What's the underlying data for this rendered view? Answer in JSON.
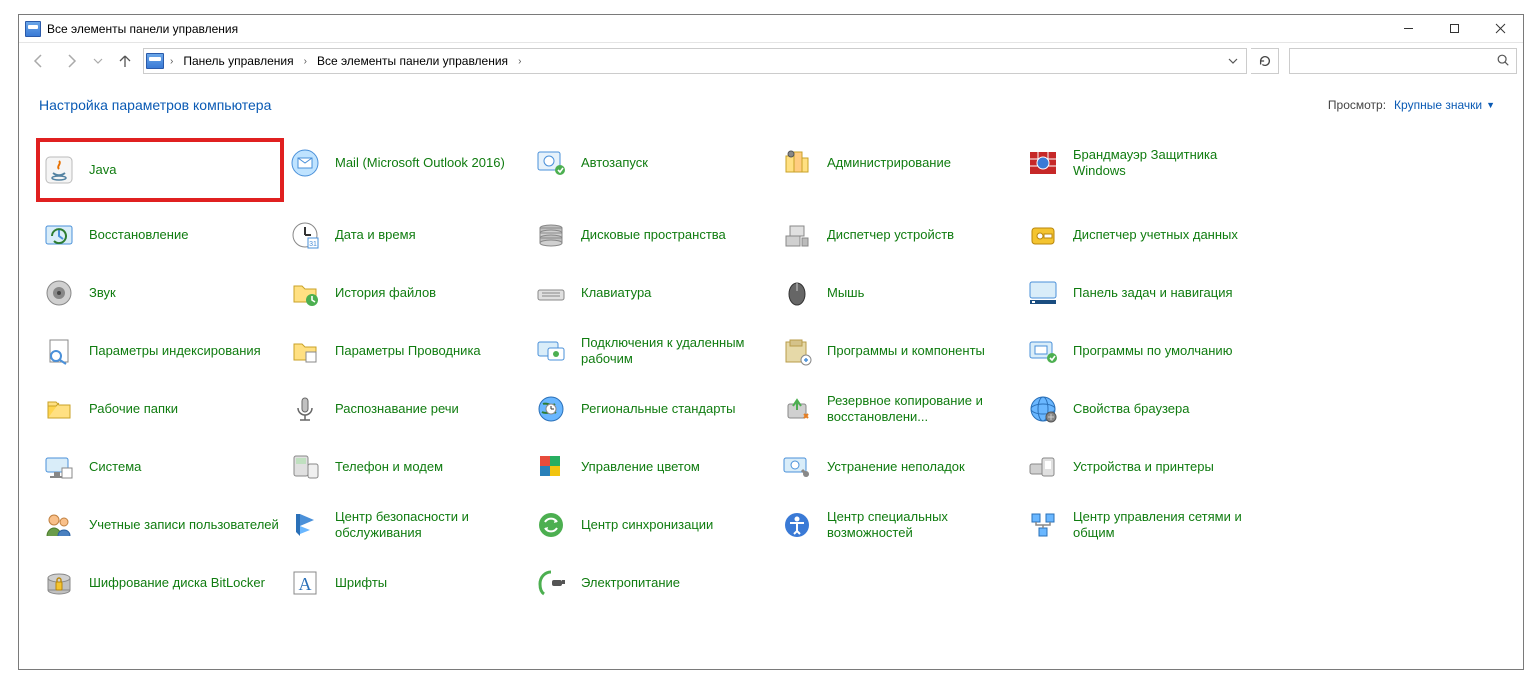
{
  "window": {
    "title": "Все элементы панели управления"
  },
  "nav": {
    "breadcrumbs": {
      "root": "Панель управления",
      "current": "Все элементы панели управления"
    },
    "search_placeholder": ""
  },
  "header": {
    "title": "Настройка параметров компьютера",
    "view_label": "Просмотр:",
    "view_value": "Крупные значки"
  },
  "items": [
    {
      "label": "Java",
      "icon": "java",
      "highlighted": true
    },
    {
      "label": "Mail (Microsoft Outlook 2016)",
      "icon": "mail"
    },
    {
      "label": "Автозапуск",
      "icon": "autoplay"
    },
    {
      "label": "Администрирование",
      "icon": "admin"
    },
    {
      "label": "Брандмауэр Защитника Windows",
      "icon": "firewall"
    },
    {
      "label": "Восстановление",
      "icon": "recovery"
    },
    {
      "label": "Дата и время",
      "icon": "datetime"
    },
    {
      "label": "Дисковые пространства",
      "icon": "storage"
    },
    {
      "label": "Диспетчер устройств",
      "icon": "devicemgr"
    },
    {
      "label": "Диспетчер учетных данных",
      "icon": "credmgr"
    },
    {
      "label": "Звук",
      "icon": "sound"
    },
    {
      "label": "История файлов",
      "icon": "filehist"
    },
    {
      "label": "Клавиатура",
      "icon": "keyboard"
    },
    {
      "label": "Мышь",
      "icon": "mouse"
    },
    {
      "label": "Панель задач и навигация",
      "icon": "taskbar"
    },
    {
      "label": "Параметры индексирования",
      "icon": "indexing"
    },
    {
      "label": "Параметры Проводника",
      "icon": "folderopt"
    },
    {
      "label": "Подключения к удаленным рабочим",
      "icon": "remoteapp"
    },
    {
      "label": "Программы и компоненты",
      "icon": "programs"
    },
    {
      "label": "Программы по умолчанию",
      "icon": "defaultprg"
    },
    {
      "label": "Рабочие папки",
      "icon": "workfolders"
    },
    {
      "label": "Распознавание речи",
      "icon": "speech"
    },
    {
      "label": "Региональные стандарты",
      "icon": "region"
    },
    {
      "label": "Резервное копирование и восстановлени...",
      "icon": "backup"
    },
    {
      "label": "Свойства браузера",
      "icon": "inetopt"
    },
    {
      "label": "Система",
      "icon": "system"
    },
    {
      "label": "Телефон и модем",
      "icon": "phone"
    },
    {
      "label": "Управление цветом",
      "icon": "color"
    },
    {
      "label": "Устранение неполадок",
      "icon": "troubleshoot"
    },
    {
      "label": "Устройства и принтеры",
      "icon": "devices"
    },
    {
      "label": "Учетные записи пользователей",
      "icon": "users"
    },
    {
      "label": "Центр безопасности и обслуживания",
      "icon": "security"
    },
    {
      "label": "Центр синхронизации",
      "icon": "sync"
    },
    {
      "label": "Центр специальных возможностей",
      "icon": "ease"
    },
    {
      "label": "Центр управления сетями и общим",
      "icon": "network"
    },
    {
      "label": "Шифрование диска BitLocker",
      "icon": "bitlocker"
    },
    {
      "label": "Шрифты",
      "icon": "fonts"
    },
    {
      "label": "Электропитание",
      "icon": "power"
    }
  ]
}
